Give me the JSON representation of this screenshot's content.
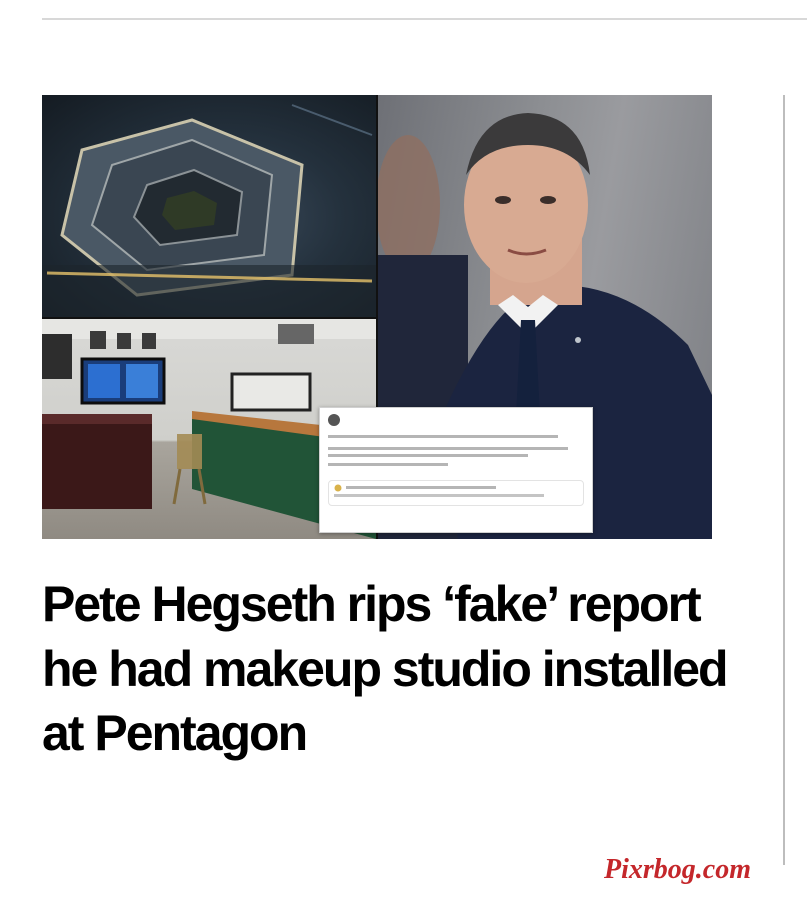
{
  "article": {
    "headline": "Pete Hegseth rips ‘fake’ report he had makeup studio installed at Pentagon"
  },
  "collage": {
    "panels": [
      {
        "name": "pentagon-aerial-photo",
        "description_icon": "aerial-photo"
      },
      {
        "name": "makeup-studio-photo",
        "description_icon": "room-photo"
      },
      {
        "name": "hegseth-portrait-photo",
        "description_icon": "portrait-photo"
      }
    ],
    "tweet": {
      "avatar_icon": "avatar-icon",
      "quote_icon": "quote-icon"
    }
  },
  "watermark": {
    "text": "Pixrbog.com"
  },
  "colors": {
    "headline": "#000000",
    "watermark": "#c4272b",
    "rule": "#d8d8d8"
  }
}
